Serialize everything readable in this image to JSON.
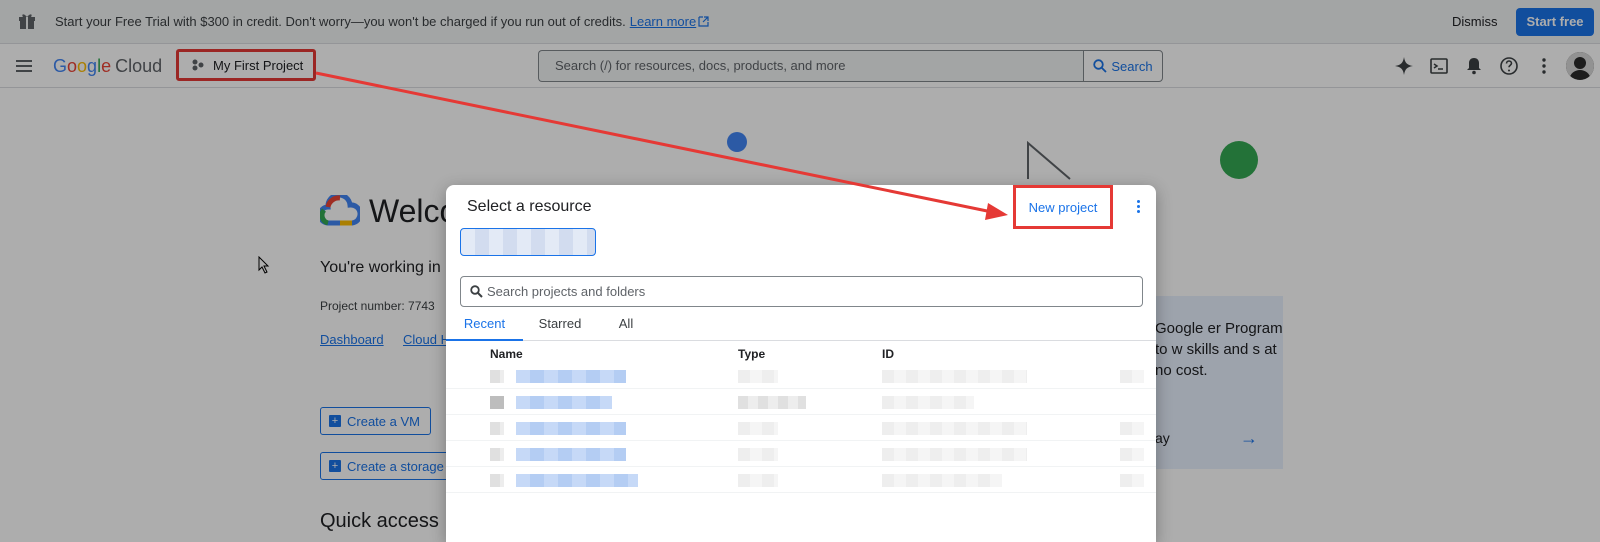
{
  "banner": {
    "message": "Start your Free Trial with $300 in credit. Don't worry—you won't be charged if you run out of credits.",
    "learn_more": "Learn more",
    "dismiss": "Dismiss",
    "start_free": "Start free"
  },
  "header": {
    "logo_google": [
      "G",
      "o",
      "o",
      "g",
      "l",
      "e"
    ],
    "logo_cloud": "Cloud",
    "project_name": "My First Project",
    "search_placeholder": "Search (/) for resources, docs, products, and more",
    "search_button": "Search"
  },
  "page": {
    "welcome_title": "Welco",
    "working_text": "You're working in",
    "project_number": "Project number:  7743",
    "links": [
      "Dashboard",
      "Cloud H"
    ],
    "create_vm": "Create a VM",
    "create_storage": "Create a storage",
    "quick_access": "Quick access",
    "promo_text": "Google er Program to w skills and s at no cost.",
    "promo_footer": "ay"
  },
  "dialog": {
    "title": "Select a resource",
    "new_project": "New project",
    "search_placeholder": "Search projects and folders",
    "tabs": [
      "Recent",
      "Starred",
      "All"
    ],
    "active_tab": "Recent",
    "columns": [
      "Name",
      "Type",
      "ID"
    ]
  },
  "colors": {
    "accent": "#1a73e8",
    "annotation": "#e53935"
  }
}
